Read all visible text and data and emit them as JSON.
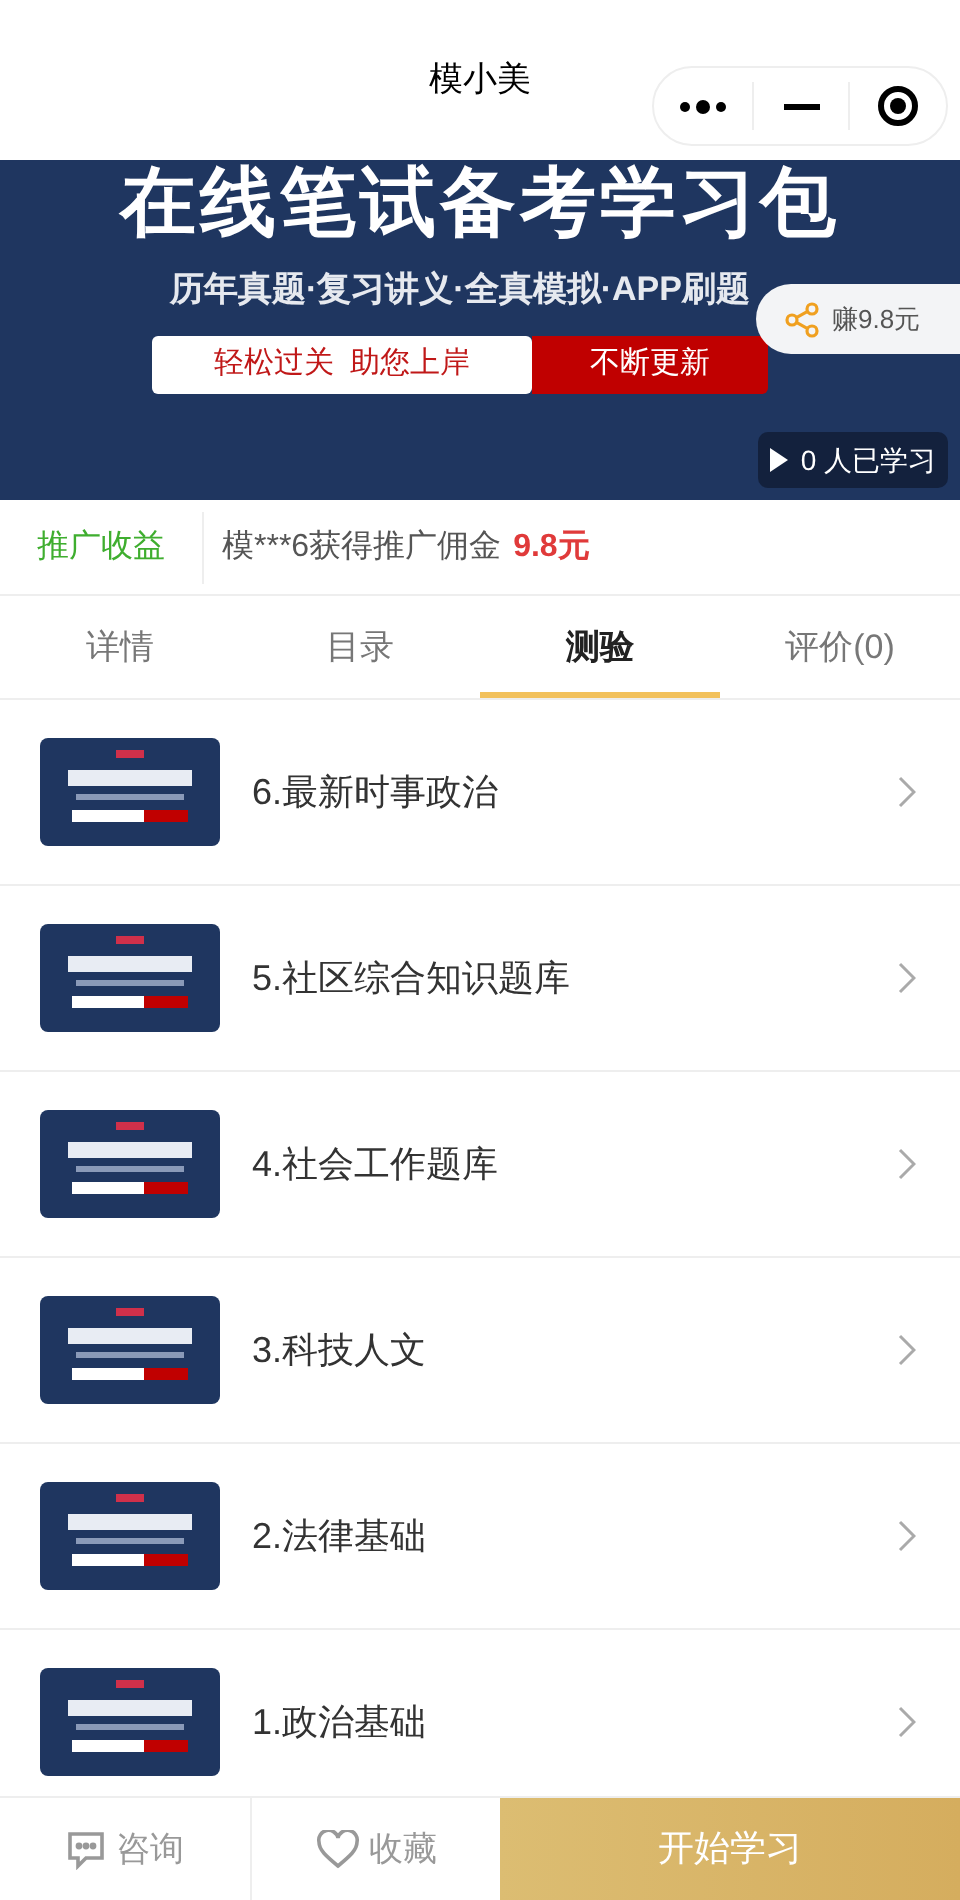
{
  "window": {
    "title": "模小美"
  },
  "banner": {
    "headline": "在线笔试备考学习包",
    "subline": "历年真题·复习讲义·全真模拟·APP刷题",
    "slogan": "轻松过关  助您上岸",
    "tag": "不断更新",
    "share_label": "赚9.8元",
    "learners": "0 人已学习"
  },
  "promo": {
    "label": "推广收益",
    "message": "模***6获得推广佣金",
    "amount": "9.8元"
  },
  "tabs": [
    {
      "label": "详情",
      "selected": false
    },
    {
      "label": "目录",
      "selected": false
    },
    {
      "label": "测验",
      "selected": true
    },
    {
      "label": "评价(0)",
      "selected": false
    }
  ],
  "quizzes": [
    {
      "title": "6.最新时事政治"
    },
    {
      "title": "5.社区综合知识题库"
    },
    {
      "title": "4.社会工作题库"
    },
    {
      "title": "3.科技人文"
    },
    {
      "title": "2.法律基础"
    },
    {
      "title": "1.政治基础"
    }
  ],
  "bottom_bar": {
    "consult": "咨询",
    "favorite": "收藏",
    "start": "开始学习"
  }
}
